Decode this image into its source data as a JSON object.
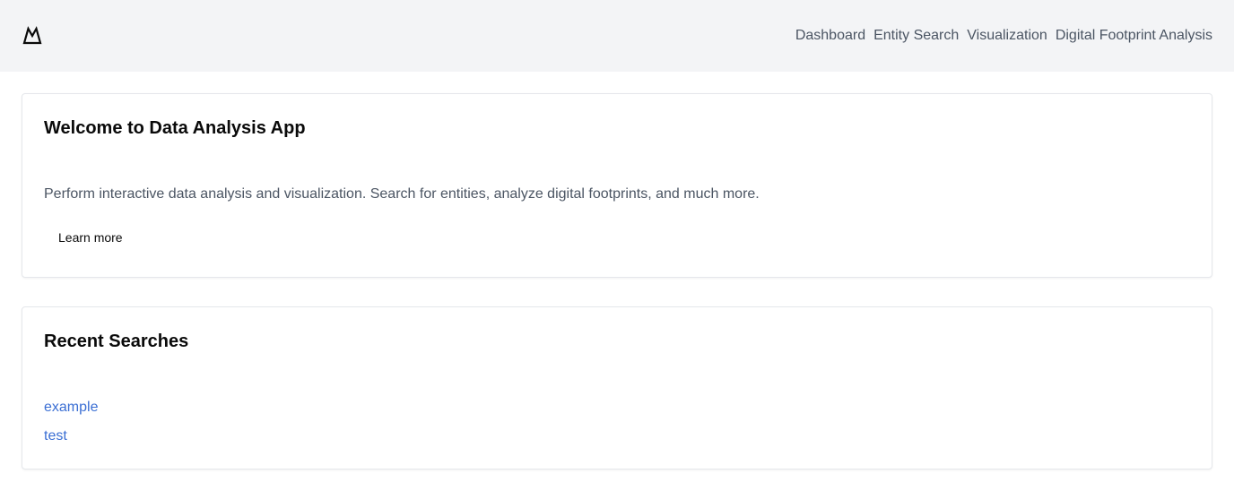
{
  "header": {
    "logo_icon": "mountain-logo-icon",
    "nav": [
      {
        "label": "Dashboard"
      },
      {
        "label": "Entity Search"
      },
      {
        "label": "Visualization"
      },
      {
        "label": "Digital Footprint Analysis"
      }
    ]
  },
  "welcome": {
    "title": "Welcome to Data Analysis App",
    "description": "Perform interactive data analysis and visualization. Search for entities, analyze digital footprints, and much more.",
    "learn_more_label": "Learn more"
  },
  "recent": {
    "title": "Recent Searches",
    "items": [
      {
        "label": "example"
      },
      {
        "label": "test"
      }
    ]
  },
  "colors": {
    "header_bg": "#f3f4f6",
    "link": "#3b6fd4",
    "muted_text": "#4b5563"
  }
}
